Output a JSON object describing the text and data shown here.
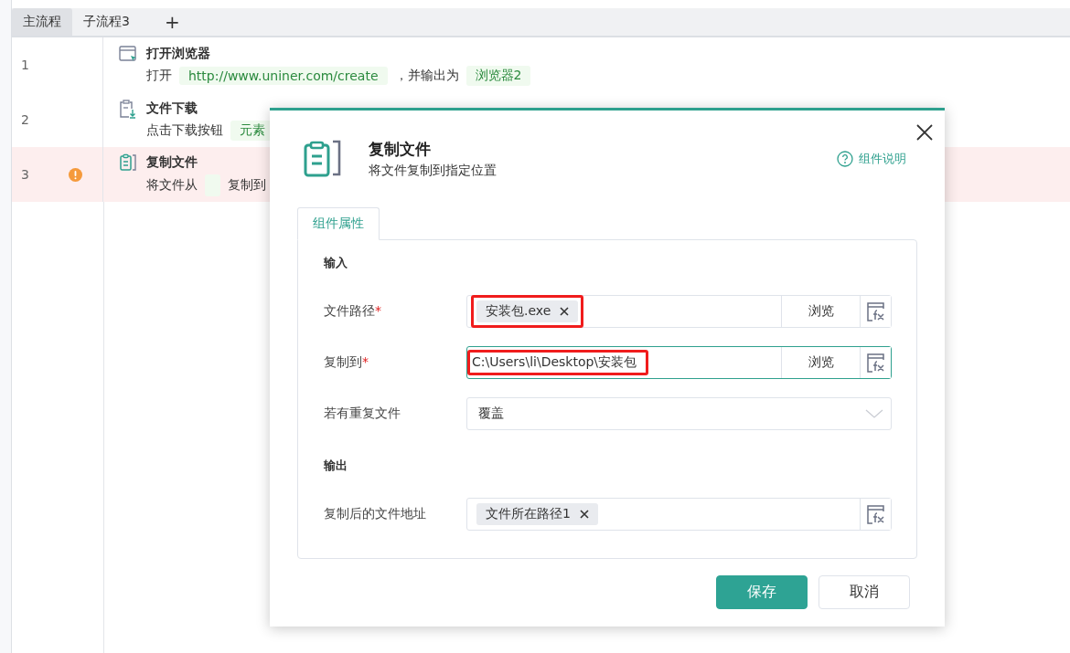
{
  "tabs": [
    {
      "label": "主流程",
      "selected": true
    },
    {
      "label": "子流程3",
      "selected": false
    }
  ],
  "add_tab": "+",
  "steps": [
    {
      "number": "1",
      "kind": "browser",
      "warning": false,
      "selected": false,
      "title": "打开浏览器",
      "parts": [
        {
          "kind": "text",
          "text": "打开"
        },
        {
          "kind": "tag",
          "text": "http://www.uniner.com/create"
        },
        {
          "kind": "text",
          "text": "，并输出为"
        },
        {
          "kind": "tag",
          "text": "浏览器2"
        }
      ]
    },
    {
      "number": "2",
      "kind": "download",
      "warning": false,
      "selected": false,
      "title": "文件下载",
      "parts": [
        {
          "kind": "text",
          "text": "点击下载按钮"
        },
        {
          "kind": "tag",
          "text": "元素"
        }
      ]
    },
    {
      "number": "3",
      "kind": "copy",
      "warning": true,
      "selected": true,
      "title": "复制文件",
      "parts": [
        {
          "kind": "text",
          "text": "将文件从"
        },
        {
          "kind": "empty_tag"
        },
        {
          "kind": "text",
          "text": "复制到"
        }
      ]
    }
  ],
  "dialog": {
    "title": "复制文件",
    "subtitle": "将文件复制到指定位置",
    "help": "组件说明",
    "tab": "组件属性",
    "sections": [
      {
        "heading": "输入",
        "fields": [
          {
            "kind": "tags",
            "label": "文件路径",
            "mark": "*",
            "tags": [
              "安装包.exe"
            ],
            "browse": "浏览",
            "formula": true,
            "focused": false,
            "highlighted": true
          },
          {
            "kind": "text",
            "label": "复制到",
            "mark": "*",
            "value": "C:\\Users\\li\\Desktop\\安装包",
            "browse": "浏览",
            "formula": true,
            "focused": true,
            "highlighted": true
          },
          {
            "kind": "select",
            "label": "若有重复文件",
            "value": "覆盖",
            "formula": false,
            "focused": false,
            "highlighted": false
          }
        ]
      },
      {
        "heading": "输出",
        "fields": [
          {
            "kind": "tags",
            "label": "复制后的文件地址",
            "tags": [
              "文件所在路径1"
            ],
            "formula": true,
            "focused": false,
            "highlighted": false
          }
        ]
      }
    ],
    "buttons": [
      {
        "label": "保存",
        "primary": true
      },
      {
        "label": "取消",
        "primary": false
      }
    ]
  }
}
